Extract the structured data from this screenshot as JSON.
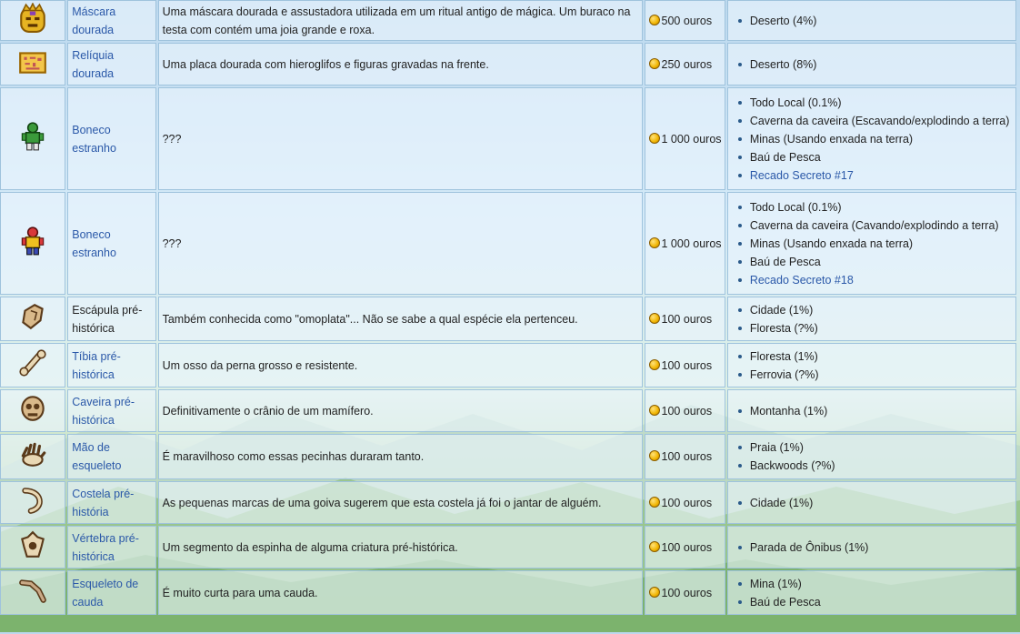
{
  "currency": "ouros",
  "rows": [
    {
      "icon": "golden-mask-icon",
      "name": "Máscara dourada",
      "name_link": true,
      "desc": "Uma máscara dourada e assustadora utilizada em um ritual antigo de mágica. Um buraco na testa com contém uma joia grande e roxa.",
      "price": "500 ouros",
      "locations": [
        {
          "text": "Deserto (4%)",
          "link": false
        }
      ]
    },
    {
      "icon": "golden-relic-icon",
      "name": "Relíquia dourada",
      "name_link": true,
      "desc": "Uma placa dourada com hieroglifos e figuras gravadas na frente.",
      "price": "250 ouros",
      "locations": [
        {
          "text": "Deserto (8%)",
          "link": false
        }
      ]
    },
    {
      "icon": "strange-doll-green-icon",
      "name": "Boneco estranho",
      "name_link": true,
      "desc": "???",
      "price": "1 000 ouros",
      "locations": [
        {
          "text": "Todo Local (0.1%)",
          "link": false
        },
        {
          "text": "Caverna da caveira (Escavando/explodindo a terra)",
          "link": false
        },
        {
          "text": "Minas (Usando enxada na terra)",
          "link": false
        },
        {
          "text": "Baú de Pesca",
          "link": false
        },
        {
          "text": "Recado Secreto #17",
          "link": true
        }
      ]
    },
    {
      "icon": "strange-doll-red-icon",
      "name": "Boneco estranho",
      "name_link": true,
      "desc": "???",
      "price": "1 000 ouros",
      "locations": [
        {
          "text": "Todo Local (0.1%)",
          "link": false
        },
        {
          "text": "Caverna da caveira (Cavando/explodindo a terra)",
          "link": false
        },
        {
          "text": "Minas (Usando enxada na terra)",
          "link": false
        },
        {
          "text": "Baú de Pesca",
          "link": false
        },
        {
          "text": "Recado Secreto #18",
          "link": true
        }
      ]
    },
    {
      "icon": "scapula-icon",
      "name": "Escápula pré-histórica",
      "name_link": false,
      "desc": "Também conhecida como \"omoplata\"... Não se sabe a qual espécie ela pertenceu.",
      "price": "100 ouros",
      "locations": [
        {
          "text": "Cidade (1%)",
          "link": false
        },
        {
          "text": "Floresta (?%)",
          "link": false
        }
      ]
    },
    {
      "icon": "tibia-icon",
      "name": "Tíbia pré-histórica",
      "name_link": true,
      "desc": "Um osso da perna grosso e resistente.",
      "price": "100 ouros",
      "locations": [
        {
          "text": "Floresta (1%)",
          "link": false
        },
        {
          "text": "Ferrovia (?%)",
          "link": false
        }
      ]
    },
    {
      "icon": "skull-icon",
      "name": "Caveira pré-histórica",
      "name_link": true,
      "desc": "Definitivamente o crânio de um mamífero.",
      "price": "100 ouros",
      "locations": [
        {
          "text": "Montanha (1%)",
          "link": false
        }
      ]
    },
    {
      "icon": "skeletal-hand-icon",
      "name": "Mão de esqueleto",
      "name_link": true,
      "desc": "É maravilhoso como essas pecinhas duraram tanto.",
      "price": "100 ouros",
      "locations": [
        {
          "text": "Praia (1%)",
          "link": false
        },
        {
          "text": "Backwoods (?%)",
          "link": false
        }
      ]
    },
    {
      "icon": "rib-icon",
      "name": "Costela pré-história",
      "name_link": true,
      "desc": "As pequenas marcas de uma goiva sugerem que esta costela já foi o jantar de alguém.",
      "price": "100 ouros",
      "locations": [
        {
          "text": "Cidade (1%)",
          "link": false
        }
      ]
    },
    {
      "icon": "vertebra-icon",
      "name": "Vértebra pré-histórica",
      "name_link": true,
      "desc": "Um segmento da espinha de alguma criatura pré-histórica.",
      "price": "100 ouros",
      "locations": [
        {
          "text": "Parada de Ônibus (1%)",
          "link": false
        }
      ]
    },
    {
      "icon": "tailbone-icon",
      "name": "Esqueleto de cauda",
      "name_link": true,
      "desc": "É muito curta para uma cauda.",
      "price": "100 ouros",
      "locations": [
        {
          "text": "Mina (1%)",
          "link": false
        },
        {
          "text": "Baú de Pesca",
          "link": false
        }
      ]
    }
  ]
}
